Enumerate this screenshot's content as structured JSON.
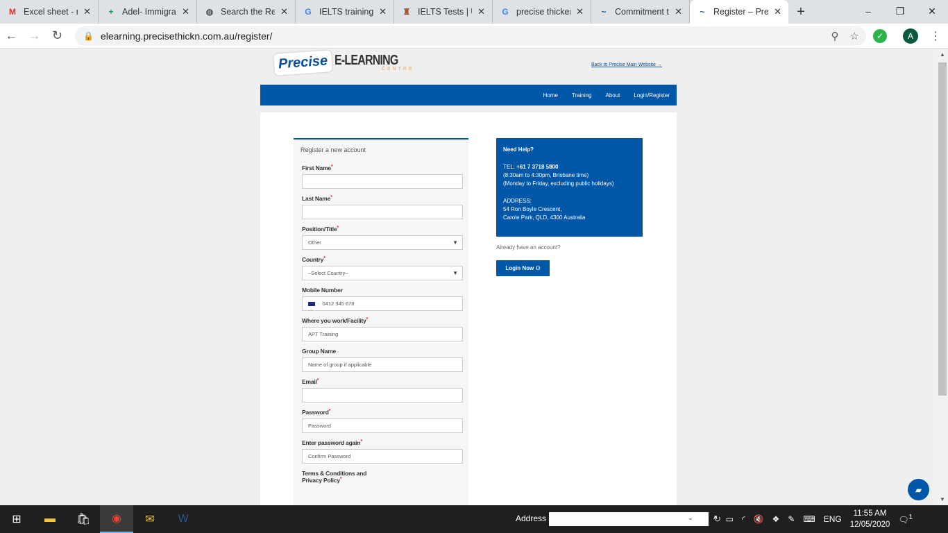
{
  "browser": {
    "tabs": [
      {
        "title": "Excel sheet - ra",
        "icon": "gmail-icon",
        "glyph": "M",
        "color": "#d93025"
      },
      {
        "title": "Adel- Immigra",
        "icon": "sheets-icon",
        "glyph": "+",
        "color": "#0f9d58"
      },
      {
        "title": "Search the Reg",
        "icon": "globe-icon",
        "glyph": "◍",
        "color": "#555555"
      },
      {
        "title": "IELTS training c",
        "icon": "google-icon",
        "glyph": "G",
        "color": "#4285f4"
      },
      {
        "title": "IELTS Tests | UI",
        "icon": "crest-icon",
        "glyph": "♜",
        "color": "#a0522d"
      },
      {
        "title": "precise thicken",
        "icon": "google-icon",
        "glyph": "G",
        "color": "#4285f4"
      },
      {
        "title": "Commitment t",
        "icon": "precise-icon",
        "glyph": "~",
        "color": "#0b4f9c"
      },
      {
        "title": "Register – Prec",
        "icon": "precise-icon",
        "glyph": "~",
        "color": "#0b4f9c",
        "active": true
      }
    ],
    "url": "elearning.precisethickn.com.au/register/",
    "avatar": "A"
  },
  "site": {
    "logo_text": "Precise",
    "logo_title": "E-LEARNING",
    "logo_sub": "CENTRE",
    "back_link": "Back to Precise Main Website →",
    "nav": [
      "Home",
      "Training",
      "About",
      "Login/Register"
    ],
    "brand_color": "#0057a8"
  },
  "form": {
    "heading": "Register a new account",
    "fields": [
      {
        "label": "First Name",
        "required": true,
        "value": "",
        "type": "text"
      },
      {
        "label": "Last Name",
        "required": true,
        "value": "",
        "type": "text"
      },
      {
        "label": "Position/Title",
        "required": true,
        "value": "Other",
        "type": "select"
      },
      {
        "label": "Country",
        "required": true,
        "value": "–Select Country–",
        "type": "select"
      },
      {
        "label": "Mobile Number",
        "required": false,
        "value": "0412 345 678",
        "type": "phone"
      },
      {
        "label": "Where you work/Facility",
        "required": true,
        "value": "APT Training",
        "type": "text"
      },
      {
        "label": "Group Name",
        "required": false,
        "value": "Name of group if applicable",
        "type": "text"
      },
      {
        "label": "Email",
        "required": true,
        "value": "",
        "type": "text"
      },
      {
        "label": "Password",
        "required": true,
        "value": "Password",
        "type": "text"
      },
      {
        "label": "Enter password again",
        "required": true,
        "value": "Confirm Password",
        "type": "text"
      }
    ],
    "terms_label_1": "Terms & Conditions and",
    "terms_label_2": "Privacy Policy"
  },
  "help": {
    "title": "Need Help?",
    "tel_label": "TEL:",
    "tel": "+61 7 3718 5800",
    "hours": "(8:30am to 4:30pm, Brisbane time)",
    "days": "(Monday to Friday, excluding public holidays)",
    "address_label": "ADDRESS:",
    "address1": "54 Ron Boyle Crescent,",
    "address2": "Carole Park, QLD, 4300 Australia"
  },
  "login": {
    "prompt": "Already have an account?",
    "button": "Login Now"
  },
  "taskbar": {
    "address_label": "Address",
    "lang": "ENG",
    "time": "11:55 AM",
    "date": "12/05/2020",
    "notifications": "1"
  }
}
